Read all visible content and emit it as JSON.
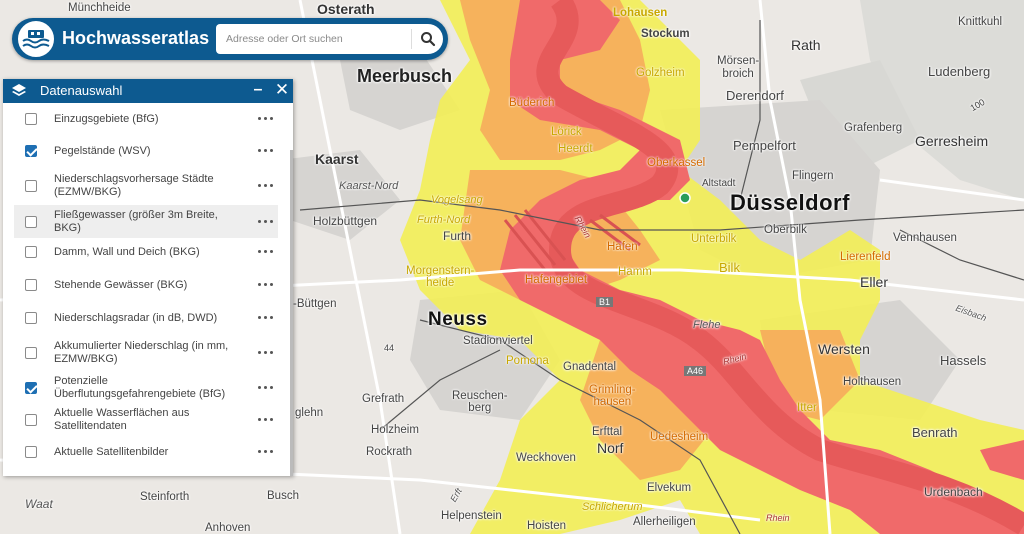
{
  "app": {
    "title": "Hochwasseratlas",
    "search_placeholder": "Adresse oder Ort suchen",
    "brand_color": "#0d5a90"
  },
  "panel": {
    "title": "Datenauswahl",
    "minimize_symbol": "–",
    "close_symbol": "✕",
    "layers": [
      {
        "label": "Einzugsgebiete (BfG)",
        "checked": false
      },
      {
        "label": "Pegelstände (WSV)",
        "checked": true
      },
      {
        "label": "Niederschlagsvorhersage Städte (EZMW/BKG)",
        "checked": false
      },
      {
        "label": "Fließgewasser (größer 3m Breite, BKG)",
        "checked": false,
        "highlighted": true
      },
      {
        "label": "Damm, Wall und Deich (BKG)",
        "checked": false
      },
      {
        "label": "Stehende Gewässer (BKG)",
        "checked": false
      },
      {
        "label": "Niederschlagsradar (in dB, DWD)",
        "checked": false
      },
      {
        "label": "Akkumulierter Niederschlag (in mm, EZMW/BKG)",
        "checked": false
      },
      {
        "label": "Potenzielle Überflutungsgefahrengebiete (BfG)",
        "checked": true
      },
      {
        "label": "Aktuelle Wasserflächen aus Satellitendaten",
        "checked": false
      },
      {
        "label": "Aktuelle Satellitenbilder",
        "checked": false
      }
    ]
  },
  "map": {
    "colors": {
      "flood_high": "#f06a6a",
      "flood_mid": "#f5b060",
      "flood_low": "#f2ee50",
      "base": "#e9e6e2"
    },
    "labels": {
      "muenchheide": "Münchheide",
      "osterath": "Osterath",
      "lohausen": "Lohausen",
      "stockum": "Stockum",
      "knittkuhl": "Knittkuhl",
      "rath": "Rath",
      "meerbusch": "Meerbusch",
      "golzheim": "Golzheim",
      "morsenbroich": "Mörsen-\nbroich",
      "ludenberg": "Ludenberg",
      "derendorf": "Derendorf",
      "buederich": "Büderich",
      "loerick": "Lörick",
      "grafenberg": "Grafenberg",
      "gerresheim": "Gerresheim",
      "pempelfort": "Pempelfort",
      "heerdt": "Heerdt",
      "kaarst": "Kaarst",
      "oberkassel": "Oberkassel",
      "flingern": "Flingern",
      "altstadt": "Altstadt",
      "kaarstnord": "Kaarst-Nord",
      "vogelsang": "Vogelsang",
      "duesseldorf": "Düsseldorf",
      "holzbuettgen": "Holzbüttgen",
      "furthnord": "Furth-Nord",
      "oberbilk": "Oberbilk",
      "hafen": "Hafen",
      "unterbilk": "Unterbilk",
      "vennhausen": "Vennhausen",
      "furth": "Furth",
      "lierenfeld": "Lierenfeld",
      "hamm": "Hamm",
      "bilk": "Bilk",
      "morgensternsheide": "Morgenstern-\nheide",
      "hafengebiet": "Hafengebiet",
      "eller": "Eller",
      "buettgen": "-Büttgen",
      "neuss": "Neuss",
      "flehe": "Flehe",
      "stadionviertel": "Stadionviertel",
      "wersten": "Wersten",
      "pomona": "Pomona",
      "gnadental": "Gnadental",
      "holthausen": "Holthausen",
      "hassels": "Hassels",
      "grefrath": "Grefrath",
      "reuschenberg": "Reuschen-\nberg",
      "grimlinghausen": "Grimling-\nhausen",
      "itter": "Itter",
      "glehn": "glehn",
      "holzheim": "Holzheim",
      "erfttal": "Erfttal",
      "uedesheim": "Uedesheim",
      "benrath": "Benrath",
      "rockrath": "Rockrath",
      "norf": "Norf",
      "weckhoven": "Weckhoven",
      "elvekum": "Elvekum",
      "urdenbach": "Urdenbach",
      "waat": "Waat",
      "steinforth": "Steinforth",
      "busch": "Busch",
      "helpenstein": "Helpenstein",
      "schlicherum": "Schlicherum",
      "anhoven": "Anhoven",
      "hoisten": "Hoisten",
      "allerheiligen": "Allerheiligen",
      "rhein1": "Rhein",
      "rhein2": "Rhein",
      "rhein3": "Rhein",
      "a46": "A46",
      "b1": "B1",
      "num44": "44",
      "num100": "100",
      "eisbach": "Eisbach",
      "erft": "Erft"
    }
  }
}
